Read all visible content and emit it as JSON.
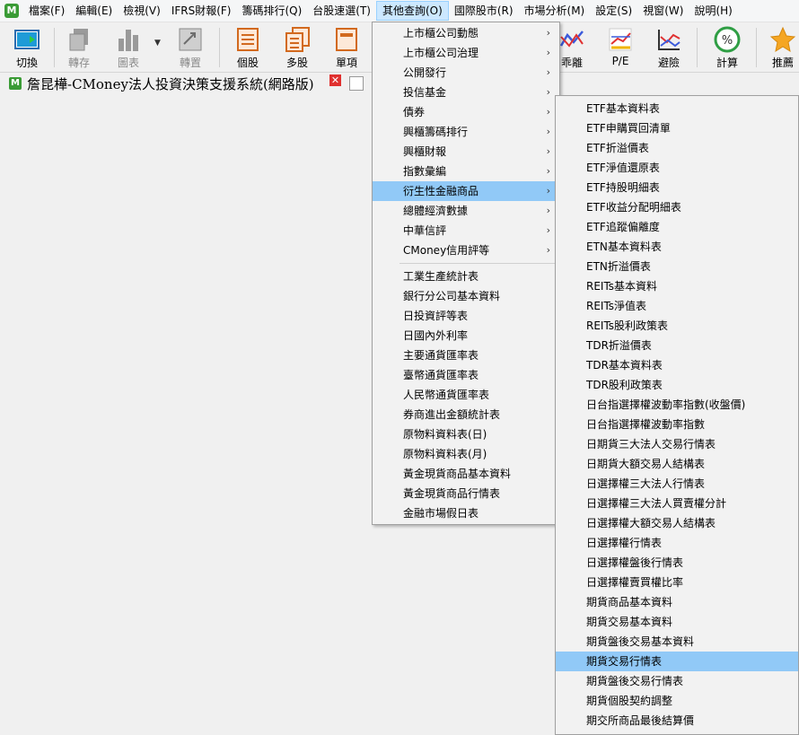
{
  "menubar": {
    "app_icon": "M",
    "items": [
      "檔案(F)",
      "編輯(E)",
      "檢視(V)",
      "IFRS財報(F)",
      "籌碼排行(Q)",
      "台股速選(T)",
      "其他查詢(O)",
      "國際股市(R)",
      "市場分析(M)",
      "設定(S)",
      "視窗(W)",
      "說明(H)"
    ],
    "active_index": 6
  },
  "toolbar": {
    "buttons": [
      {
        "label": "切換",
        "icon": "switch-icon"
      },
      {
        "label": "轉存",
        "icon": "export-icon"
      },
      {
        "label": "圖表",
        "icon": "chart-icon"
      },
      {
        "label": "轉置",
        "icon": "transpose-icon"
      },
      {
        "label": "個股",
        "icon": "single-stock-icon"
      },
      {
        "label": "多股",
        "icon": "multi-stock-icon"
      },
      {
        "label": "單項",
        "icon": "single-item-icon"
      },
      {
        "label": "乖離",
        "icon": "deviation-icon"
      },
      {
        "label": "P/E",
        "icon": "pe-icon"
      },
      {
        "label": "避險",
        "icon": "hedge-icon"
      },
      {
        "label": "計算",
        "icon": "percent-icon"
      },
      {
        "label": "推薦",
        "icon": "star-icon"
      }
    ]
  },
  "tab": {
    "title": "詹昆樺-CMoney法人投資決策支援系統(網路版)",
    "close": "✕"
  },
  "other_query_menu": {
    "items": [
      {
        "label": "上市櫃公司動態",
        "submenu": true
      },
      {
        "label": "上市櫃公司治理",
        "submenu": true
      },
      {
        "label": "公開發行",
        "submenu": true
      },
      {
        "label": "投信基金",
        "submenu": true
      },
      {
        "label": "債券",
        "submenu": true
      },
      {
        "label": "興櫃籌碼排行",
        "submenu": true
      },
      {
        "label": "興櫃財報",
        "submenu": true
      },
      {
        "label": "指數彙編",
        "submenu": true
      },
      {
        "label": "衍生性金融商品",
        "submenu": true
      },
      {
        "label": "總體經濟數據",
        "submenu": true
      },
      {
        "label": "中華信評",
        "submenu": true
      },
      {
        "label": "CMoney信用評等",
        "submenu": true
      }
    ],
    "items2": [
      "工業生產統計表",
      "銀行分公司基本資料",
      "日投資評等表",
      "日國內外利率",
      "主要通貨匯率表",
      "臺幣通貨匯率表",
      "人民幣通貨匯率表",
      "券商進出金額統計表",
      "原物料資料表(日)",
      "原物料資料表(月)",
      "黃金現貨商品基本資料",
      "黃金現貨商品行情表",
      "金融市場假日表"
    ],
    "highlight_index": 8,
    "arrow": "›"
  },
  "derivatives_submenu": {
    "items": [
      "ETF基本資料表",
      "ETF申購買回清單",
      "ETF折溢價表",
      "ETF淨值還原表",
      "ETF持股明細表",
      "ETF收益分配明細表",
      "ETF追蹤偏離度",
      "ETN基本資料表",
      "ETN折溢價表",
      "REITs基本資料",
      "REITs淨值表",
      "REITs股利政策表",
      "TDR折溢價表",
      "TDR基本資料表",
      "TDR股利政策表",
      "日台指選擇權波動率指數(收盤價)",
      "日台指選擇權波動率指數",
      "日期貨三大法人交易行情表",
      "日期貨大額交易人結構表",
      "日選擇權三大法人行情表",
      "日選擇權三大法人買賣權分計",
      "日選擇權大額交易人結構表",
      "日選擇權行情表",
      "日選擇權盤後行情表",
      "日選擇權賣買權比率",
      "期貨商品基本資料",
      "期貨交易基本資料",
      "期貨盤後交易基本資料",
      "期貨交易行情表",
      "期貨盤後交易行情表",
      "期貨個股契約調整",
      "期交所商品最後結算價"
    ],
    "highlight_index": 28
  },
  "colors": {
    "highlight": "#91c9f7",
    "menu_active": "#cce8ff",
    "brand_green": "#3a9b35"
  }
}
